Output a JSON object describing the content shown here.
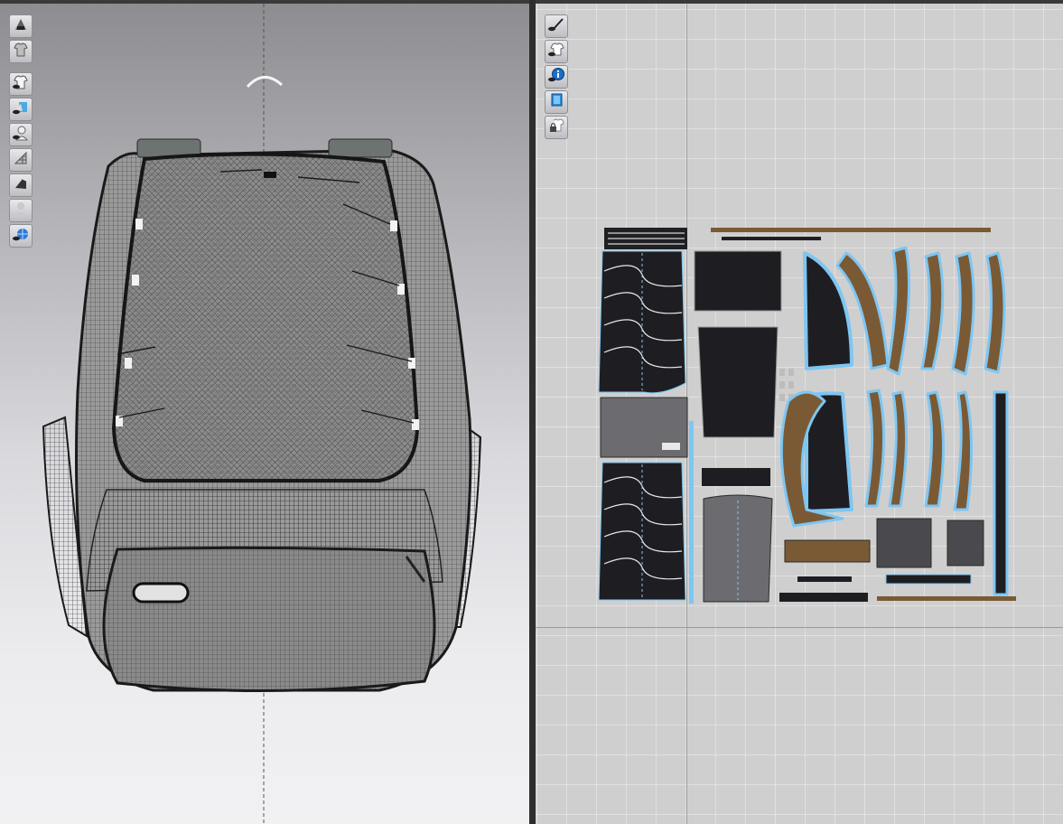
{
  "viewport_3d": {
    "toolbar": [
      {
        "icon": "avatar-display-icon"
      },
      {
        "icon": "garment-display-icon"
      },
      {
        "icon": "show-garment-icon"
      },
      {
        "icon": "texture-display-icon"
      },
      {
        "icon": "show-avatar-icon"
      },
      {
        "icon": "mesh-display-icon"
      },
      {
        "icon": "thickness-display-icon"
      },
      {
        "icon": "avatar-silhouette-icon"
      },
      {
        "icon": "globe-render-icon"
      }
    ],
    "object": "backpack-wireframe-model"
  },
  "viewport_2d": {
    "toolbar": [
      {
        "icon": "show-baseline-icon"
      },
      {
        "icon": "show-2d-garment-icon"
      },
      {
        "icon": "info-icon"
      },
      {
        "icon": "show-fabric-texture-icon"
      },
      {
        "icon": "lock-pattern-icon"
      }
    ],
    "colors": {
      "panel_dark": "#232326",
      "panel_grey": "#6c6c70",
      "panel_brown": "#7a5a35",
      "selection_outline": "#7ec6f2",
      "seam_line": "#7ec6f2"
    }
  }
}
